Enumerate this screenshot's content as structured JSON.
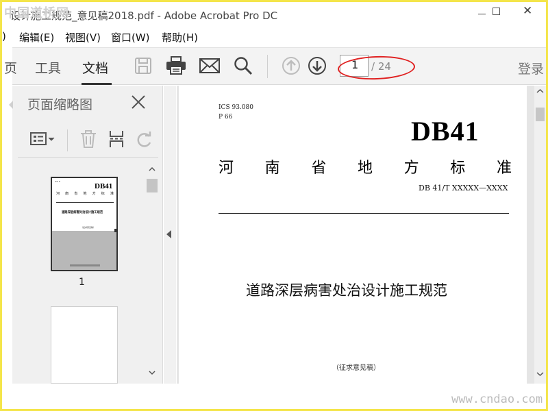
{
  "window": {
    "title": "设计施工规范_意见稿2018.pdf - Adobe Acrobat Pro DC",
    "controls": {
      "minimize_label": "—",
      "maximize_label": "□",
      "close_label": "✕"
    }
  },
  "watermarks": {
    "top": "中国道桥网",
    "bottom": "www.cndao.com"
  },
  "menu": {
    "items": [
      {
        "label": ")"
      },
      {
        "label": "编辑(E)"
      },
      {
        "label": "视图(V)"
      },
      {
        "label": "窗口(W)"
      },
      {
        "label": "帮助(H)"
      }
    ]
  },
  "toolbar": {
    "tabs": [
      {
        "label": "页"
      },
      {
        "label": "工具"
      },
      {
        "label": "文档"
      }
    ],
    "active_tab": "文档",
    "icons": [
      "save-icon",
      "print-icon",
      "email-icon",
      "search-icon",
      "page-up-icon",
      "page-down-icon"
    ],
    "page_current": "1",
    "page_total": "/ 24",
    "login_label": "登录"
  },
  "left_panel": {
    "title": "页面缩略图",
    "tools": [
      "thumbnail-options-icon",
      "delete-icon",
      "insert-page-icon",
      "rotate-icon"
    ],
    "thumbnails": [
      {
        "label": "1",
        "selected": true
      },
      {
        "label": "",
        "selected": false
      }
    ]
  },
  "document": {
    "ics": "ICS  93.080",
    "p_code": "P 66",
    "db_code": "DB41",
    "std_title_chars": [
      "河",
      "南",
      "省",
      "地",
      "方",
      "标",
      "准"
    ],
    "std_no": "DB 41/T  XXXXX—XXXX",
    "main_title": "道路深层病害处治设计施工规范",
    "draft_note": "（征求意见稿）"
  },
  "colors": {
    "border": "#f4e54a",
    "highlight_ellipse": "#e02020",
    "toolbar_bg": "#f3f3f3",
    "panel_bg": "#f0f0f0"
  }
}
